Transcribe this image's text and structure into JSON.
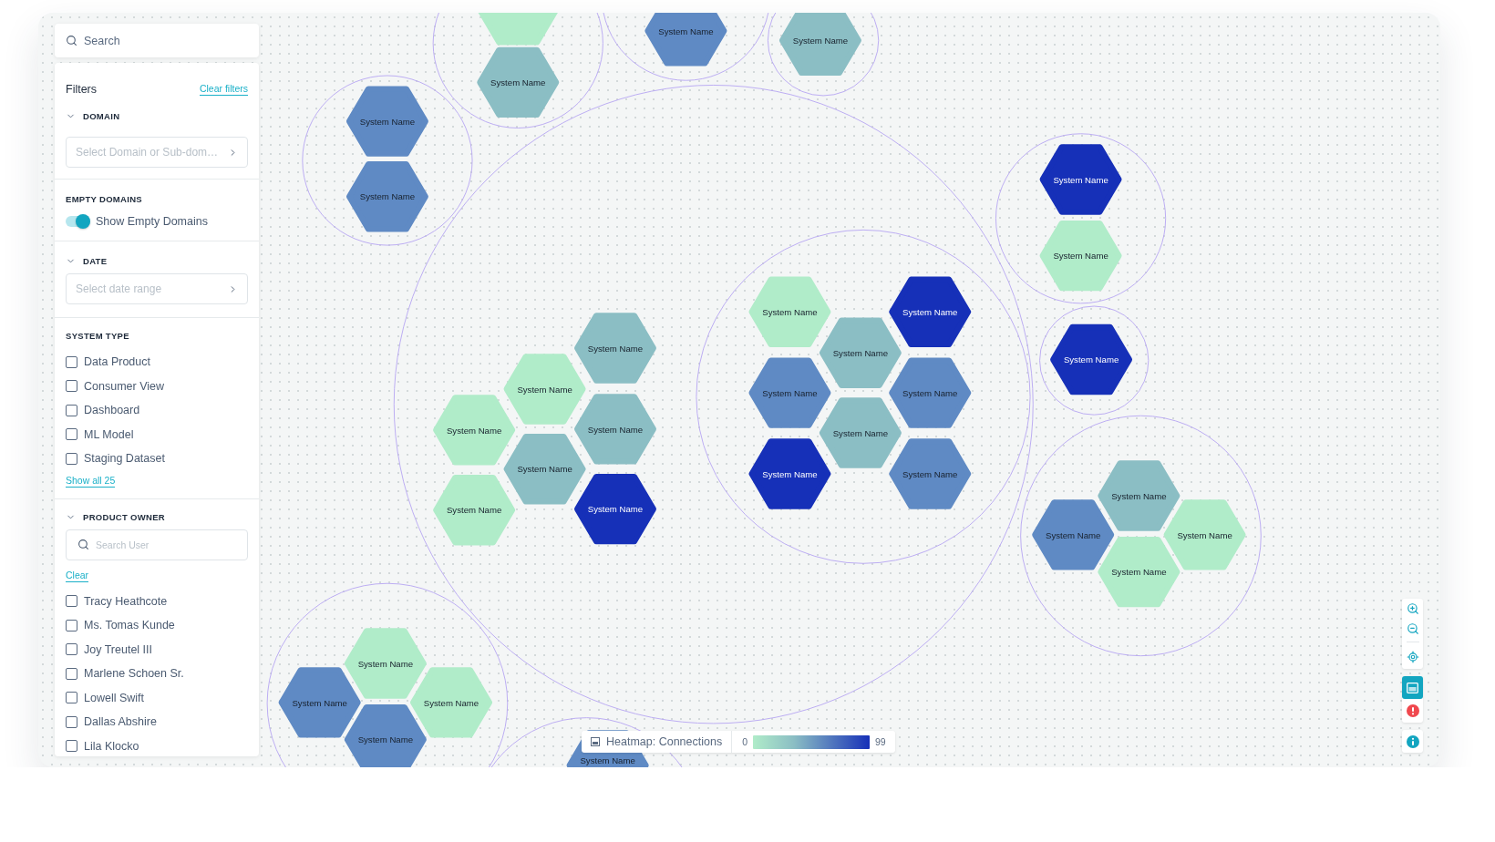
{
  "search": {
    "placeholder": "Search"
  },
  "filters": {
    "title": "Filters",
    "clear_link": "Clear filters",
    "domain": {
      "title": "DOMAIN",
      "expanded": true,
      "placeholder": "Select Domain or Sub-dom…"
    },
    "empty_domains": {
      "title": "EMPTY DOMAINS",
      "toggle_label": "Show Empty Domains",
      "on": true
    },
    "date": {
      "title": "DATE",
      "expanded": true,
      "placeholder": "Select date range"
    },
    "system_type": {
      "title": "SYSTEM TYPE",
      "show_all": "Show all 25",
      "options": [
        {
          "label": "Data Product",
          "checked": false
        },
        {
          "label": "Consumer View",
          "checked": false
        },
        {
          "label": "Dashboard",
          "checked": false
        },
        {
          "label": "ML Model",
          "checked": false
        },
        {
          "label": "Staging Dataset",
          "checked": false
        }
      ]
    },
    "product_owner": {
      "title": "PRODUCT OWNER",
      "expanded": true,
      "search_placeholder": "Search User",
      "clear": "Clear",
      "options": [
        {
          "label": "Tracy Heathcote",
          "checked": false
        },
        {
          "label": "Ms. Tomas Kunde",
          "checked": false
        },
        {
          "label": "Joy Treutel III",
          "checked": false
        },
        {
          "label": "Marlene Schoen Sr.",
          "checked": false
        },
        {
          "label": "Lowell Swift",
          "checked": false
        },
        {
          "label": "Dallas Abshire",
          "checked": false
        },
        {
          "label": "Lila Klocko",
          "checked": false
        }
      ]
    }
  },
  "map": {
    "nodes": [
      {
        "color": "#b0ecc9"
      },
      {
        "label": "System Name",
        "color": "#8bbec4"
      },
      {
        "label": "System Name",
        "color": "#5f8ac4"
      },
      {
        "label": "System Name",
        "color": "#8bbec4"
      },
      {
        "label": "System Name",
        "color": "#5f8ac4"
      },
      {
        "label": "System Name",
        "color": "#5f8ac4"
      },
      {
        "label": "System Name",
        "color": "#8bbec4"
      },
      {
        "label": "System Name",
        "color": "#b0ecc9"
      },
      {
        "label": "System Name",
        "color": "#b0ecc9"
      },
      {
        "label": "System Name",
        "color": "#8bbec4"
      },
      {
        "label": "System Name",
        "color": "#8bbec4"
      },
      {
        "label": "System Name",
        "color": "#b0ecc9"
      },
      {
        "label": "System Name",
        "color": "#1630b8"
      },
      {
        "label": "System Name",
        "color": "#b0ecc9"
      },
      {
        "label": "System Name",
        "color": "#1630b8"
      },
      {
        "label": "System Name",
        "color": "#8bbec4"
      },
      {
        "label": "System Name",
        "color": "#5f8ac4"
      },
      {
        "label": "System Name",
        "color": "#5f8ac4"
      },
      {
        "label": "System Name",
        "color": "#8bbec4"
      },
      {
        "label": "System Name",
        "color": "#1630b8"
      },
      {
        "label": "System Name",
        "color": "#5f8ac4"
      },
      {
        "label": "System Name",
        "color": "#1630b8"
      },
      {
        "label": "System Name",
        "color": "#b0ecc9"
      },
      {
        "label": "System Name",
        "color": "#1630b8"
      },
      {
        "label": "System Name",
        "color": "#8bbec4"
      },
      {
        "label": "System Name",
        "color": "#5f8ac4"
      },
      {
        "label": "System Name",
        "color": "#b0ecc9"
      },
      {
        "label": "System Name",
        "color": "#b0ecc9"
      },
      {
        "label": "System Name",
        "color": "#b0ecc9"
      },
      {
        "label": "System Name",
        "color": "#5f8ac4"
      },
      {
        "label": "System Name",
        "color": "#b0ecc9"
      },
      {
        "label": "System Name",
        "color": "#5f8ac4"
      },
      {
        "label": "System Name",
        "color": "#5f8ac4"
      }
    ]
  },
  "legend": {
    "title": "Heatmap: Connections",
    "min": "0",
    "max": "99"
  },
  "controls": {
    "heatmap_selected": true
  }
}
